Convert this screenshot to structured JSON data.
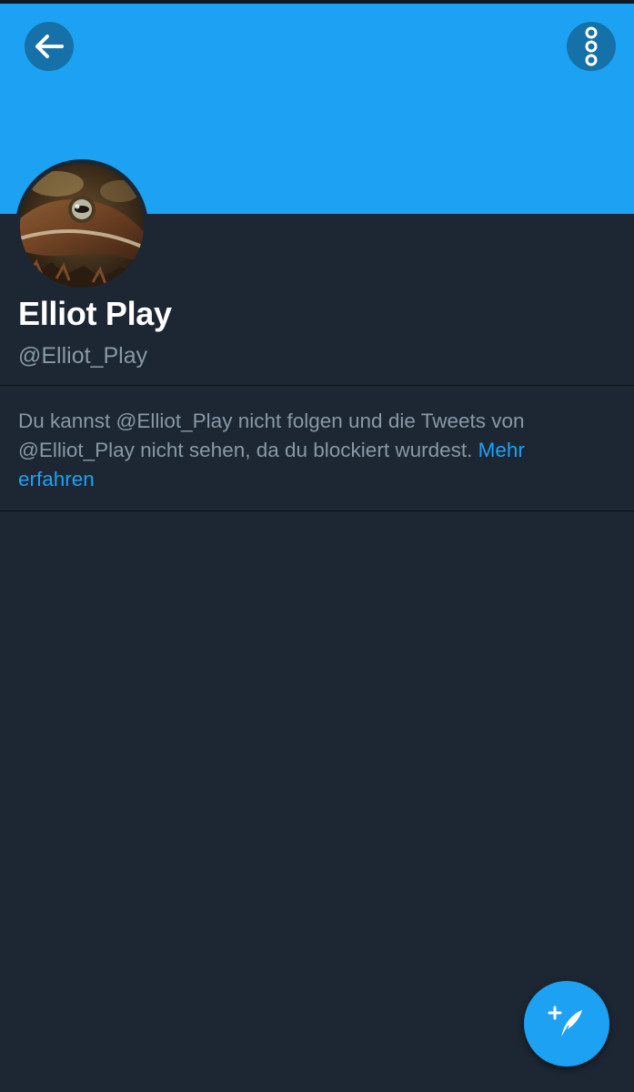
{
  "header": {
    "back_icon": "arrow-left-icon",
    "more_icon": "more-vertical-icon",
    "banner_color": "#1da1f2"
  },
  "profile": {
    "name": "Elliot Play",
    "handle": "@Elliot_Play",
    "avatar": "frog-photo"
  },
  "blocked_notice": {
    "text": "Du kannst @Elliot_Play nicht folgen und die Tweets von @Elliot_Play nicht sehen, da du blockiert wurdest. ",
    "link_text": "Mehr erfahren",
    "link_color": "#1da1f2"
  },
  "fab": {
    "icon": "compose-tweet-icon"
  },
  "colors": {
    "background": "#1c2733",
    "name": "#ffffff",
    "secondary_text": "#8899a6"
  }
}
